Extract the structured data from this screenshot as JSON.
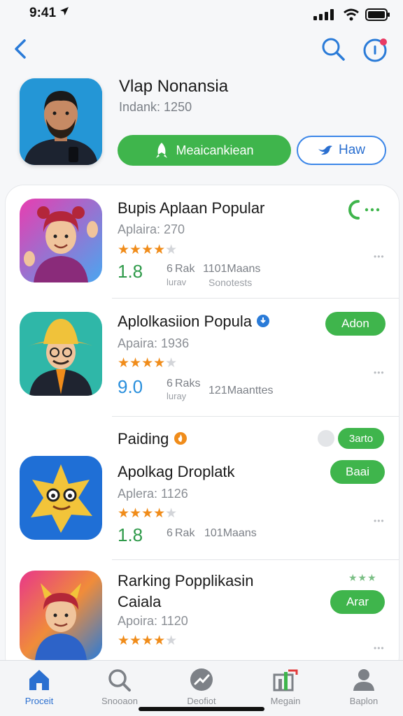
{
  "status": {
    "time": "9:41"
  },
  "hero": {
    "title": "Vlap Nonansia",
    "subtitle": "Indank: 1250",
    "primary_button": "Meaicankiean",
    "secondary_button": "Haw"
  },
  "apps": [
    {
      "title": "Bupis Aplaan Popular",
      "subtitle": "Aplaira: 270",
      "rating": "1.8",
      "mid": "6",
      "meta1_top": "Rak",
      "meta1_bottom": "lurav",
      "meta2_top": "1101Maans",
      "meta2_bottom": "Sonotests",
      "stars": 4.5
    },
    {
      "title": "Aplolkasiion Popula",
      "subtitle": "Apaira: 1936",
      "rating": "9.0",
      "mid": "6",
      "meta1_top": "Raks",
      "meta1_bottom": "luray",
      "meta2_top": "121Maanttes",
      "button": "Adon",
      "stars": 4.5
    },
    {
      "section_label": "Paiding",
      "section_button": "3arto",
      "title": "Apolkag Droplatk",
      "subtitle": "Aplera: 1126",
      "rating": "1.8",
      "mid": "6",
      "meta1_top": "Rak",
      "meta2_top": "101Maans",
      "button": "Baai",
      "stars": 4.5
    },
    {
      "title": "Rarking Popplikasin",
      "title2": "Caiala",
      "subtitle": "Apoira: 1120",
      "button": "Arar",
      "stars": 4.5
    }
  ],
  "tabs": [
    {
      "label": "Proceit",
      "icon": "home-icon",
      "active": true
    },
    {
      "label": "Snooaon",
      "icon": "search-icon"
    },
    {
      "label": "Deofiot",
      "icon": "trending-icon"
    },
    {
      "label": "Megain",
      "icon": "chart-icon"
    },
    {
      "label": "Baplon",
      "icon": "profile-icon"
    }
  ],
  "colors": {
    "accent_green": "#3fb54c",
    "accent_blue": "#2a6fd0",
    "star_orange": "#f08c1a"
  }
}
